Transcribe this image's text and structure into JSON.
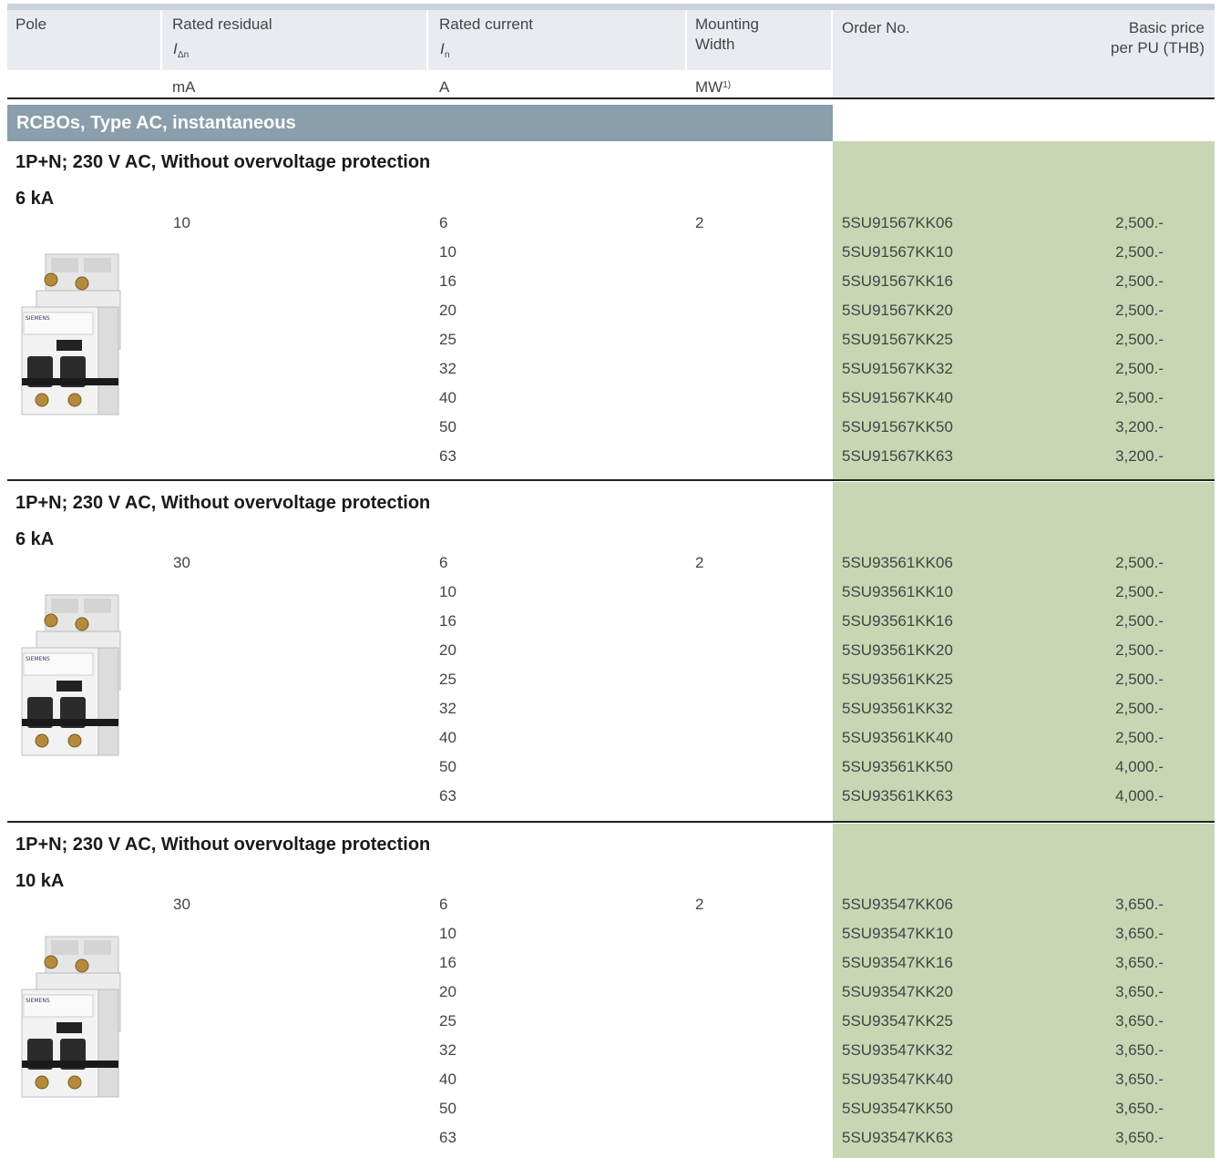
{
  "columns": {
    "pole": "Pole",
    "residual_label": "Rated residual",
    "residual_symbol": "I",
    "residual_sub": "Δn",
    "residual_unit": "mA",
    "current_label": "Rated current",
    "current_symbol": "I",
    "current_sub": "n",
    "current_unit": "A",
    "mw_label_1": "Mounting",
    "mw_label_2": "Width",
    "mw_unit": "MW",
    "mw_note": "1)",
    "order_no": "Order No.",
    "price_1": "Basic price",
    "price_2": "per PU (THB)"
  },
  "section_title": "RCBOs, Type AC, instantaneous",
  "groups": [
    {
      "title": "1P+N; 230 V AC, Without overvoltage protection",
      "breaking": "6 kA",
      "residual": "10",
      "mw": "2",
      "rows": [
        {
          "current": "6",
          "order": "5SU91567KK06",
          "price": "2,500.-"
        },
        {
          "current": "10",
          "order": "5SU91567KK10",
          "price": "2,500.-"
        },
        {
          "current": "16",
          "order": "5SU91567KK16",
          "price": "2,500.-"
        },
        {
          "current": "20",
          "order": "5SU91567KK20",
          "price": "2,500.-"
        },
        {
          "current": "25",
          "order": "5SU91567KK25",
          "price": "2,500.-"
        },
        {
          "current": "32",
          "order": "5SU91567KK32",
          "price": "2,500.-"
        },
        {
          "current": "40",
          "order": "5SU91567KK40",
          "price": "2,500.-"
        },
        {
          "current": "50",
          "order": "5SU91567KK50",
          "price": "3,200.-"
        },
        {
          "current": "63",
          "order": "5SU91567KK63",
          "price": "3,200.-"
        }
      ]
    },
    {
      "title": "1P+N; 230 V AC, Without overvoltage protection",
      "breaking": "6 kA",
      "residual": "30",
      "mw": "2",
      "rows": [
        {
          "current": "6",
          "order": "5SU93561KK06",
          "price": "2,500.-"
        },
        {
          "current": "10",
          "order": "5SU93561KK10",
          "price": "2,500.-"
        },
        {
          "current": "16",
          "order": "5SU93561KK16",
          "price": "2,500.-"
        },
        {
          "current": "20",
          "order": "5SU93561KK20",
          "price": "2,500.-"
        },
        {
          "current": "25",
          "order": "5SU93561KK25",
          "price": "2,500.-"
        },
        {
          "current": "32",
          "order": "5SU93561KK32",
          "price": "2,500.-"
        },
        {
          "current": "40",
          "order": "5SU93561KK40",
          "price": "2,500.-"
        },
        {
          "current": "50",
          "order": "5SU93561KK50",
          "price": "4,000.-"
        },
        {
          "current": "63",
          "order": "5SU93561KK63",
          "price": "4,000.-"
        }
      ]
    },
    {
      "title": "1P+N; 230 V AC, Without overvoltage protection",
      "breaking": "10 kA",
      "residual": "30",
      "mw": "2",
      "rows": [
        {
          "current": "6",
          "order": "5SU93547KK06",
          "price": "3,650.-"
        },
        {
          "current": "10",
          "order": "5SU93547KK10",
          "price": "3,650.-"
        },
        {
          "current": "16",
          "order": "5SU93547KK16",
          "price": "3,650.-"
        },
        {
          "current": "20",
          "order": "5SU93547KK20",
          "price": "3,650.-"
        },
        {
          "current": "25",
          "order": "5SU93547KK25",
          "price": "3,650.-"
        },
        {
          "current": "32",
          "order": "5SU93547KK32",
          "price": "3,650.-"
        },
        {
          "current": "40",
          "order": "5SU93547KK40",
          "price": "3,650.-"
        },
        {
          "current": "50",
          "order": "5SU93547KK50",
          "price": "3,650.-"
        },
        {
          "current": "63",
          "order": "5SU93547KK63",
          "price": "3,650.-"
        }
      ]
    }
  ],
  "product_image": {
    "brand": "SIEMENS"
  }
}
